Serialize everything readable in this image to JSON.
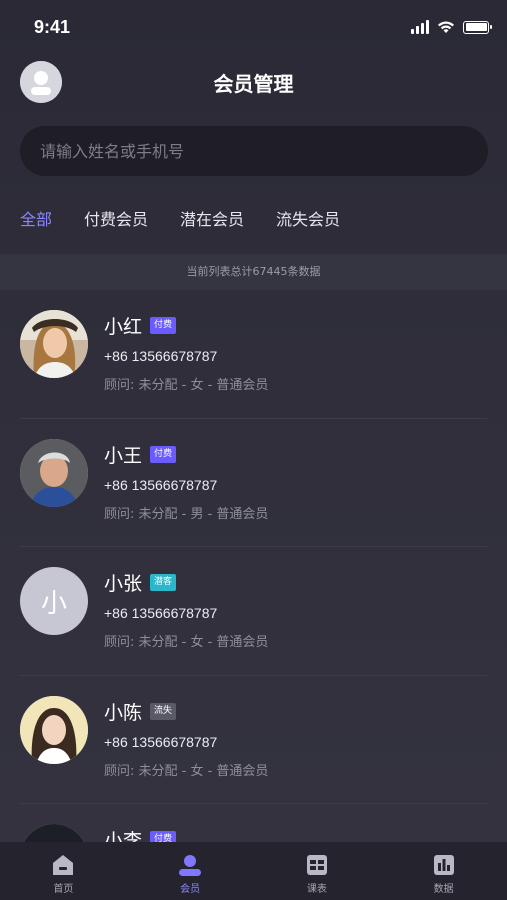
{
  "status_bar": {
    "time": "9:41"
  },
  "header": {
    "title": "会员管理"
  },
  "search": {
    "placeholder": "请输入姓名或手机号"
  },
  "tabs": [
    {
      "label": "全部",
      "active": true
    },
    {
      "label": "付费会员",
      "active": false
    },
    {
      "label": "潜在会员",
      "active": false
    },
    {
      "label": "流失会员",
      "active": false
    }
  ],
  "count_text": "当前列表总计67445条数据",
  "members": [
    {
      "name": "小红",
      "badge": "付费",
      "badge_color": "#6b5cff",
      "phone": "+86 13566678787",
      "meta": "顾问: 未分配 - 女 - 普通会员",
      "avatar": "photo-woman-1"
    },
    {
      "name": "小王",
      "badge": "付费",
      "badge_color": "#6b5cff",
      "phone": "+86 13566678787",
      "meta": "顾问: 未分配 - 男 - 普通会员",
      "avatar": "photo-man-old"
    },
    {
      "name": "小张",
      "badge": "潜客",
      "badge_color": "#2bb7c9",
      "phone": "+86 13566678787",
      "meta": "顾问: 未分配 - 女 - 普通会员",
      "avatar": "letter",
      "avatar_letter": "小"
    },
    {
      "name": "小陈",
      "badge": "流失",
      "badge_color": "#5a5966",
      "phone": "+86 13566678787",
      "meta": "顾问: 未分配 - 女 - 普通会员",
      "avatar": "photo-woman-2"
    },
    {
      "name": "小李",
      "badge": "付费",
      "badge_color": "#6b5cff",
      "phone": "",
      "meta": "",
      "avatar": "photo-dark"
    }
  ],
  "tabbar": [
    {
      "label": "首页",
      "icon": "home-icon",
      "active": false
    },
    {
      "label": "会员",
      "icon": "member-icon",
      "active": true
    },
    {
      "label": "课表",
      "icon": "schedule-icon",
      "active": false
    },
    {
      "label": "数据",
      "icon": "chart-icon",
      "active": false
    }
  ],
  "colors": {
    "accent": "#8b86ff",
    "background": "#2d2c38",
    "tabbar": "#25242e"
  }
}
